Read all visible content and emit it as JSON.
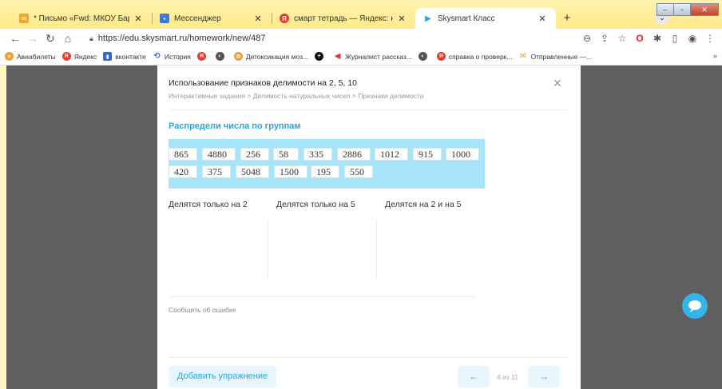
{
  "tabs": [
    {
      "title": "* Письмо «Fwd: МКОУ Барабинс",
      "favicon": "mail-icon",
      "color": "#f5a623"
    },
    {
      "title": "Мессенджер",
      "favicon": "messenger-icon",
      "color": "#3a7bd5"
    },
    {
      "title": "смарт тетрадь — Яндекс: нашёл",
      "favicon": "yandex-icon",
      "color": "#e63a2e"
    },
    {
      "title": "Skysmart Класс",
      "favicon": "skysmart-icon",
      "color": "#2aa4d9"
    }
  ],
  "address": "https://edu.skysmart.ru/homework/new/487",
  "bookmarks": [
    {
      "label": "Авиабилеты",
      "color": "#f0a030"
    },
    {
      "label": "Яндекс",
      "color": "#e63a2e"
    },
    {
      "label": "вконтакте",
      "color": "#2b6cd3"
    },
    {
      "label": "История",
      "color": "#2b6cd3"
    },
    {
      "label": "",
      "color": "#e63a2e"
    },
    {
      "label": "",
      "color": "#333333"
    },
    {
      "label": "Детоксикация моз...",
      "color": "#e8a23a"
    },
    {
      "label": "",
      "color": "#111111"
    },
    {
      "label": "Журналист рассказ...",
      "color": "#d33"
    },
    {
      "label": "",
      "color": "#333333"
    },
    {
      "label": "справка о проверк...",
      "color": "#e63a2e"
    },
    {
      "label": "Отправленные —...",
      "color": "#e9a22a"
    }
  ],
  "modal": {
    "title": "Использование признаков делимости на 2, 5, 10",
    "breadcrumbs": "Интерактивные задания > Делимость натуральных чисел > Признаки делимости",
    "task": "Распредели числа по группам",
    "numbers_row1": [
      "865",
      "4880",
      "256",
      "58",
      "335",
      "2886",
      "1012",
      "915",
      "1000"
    ],
    "numbers_row2": [
      "420",
      "375",
      "5048",
      "1500",
      "195",
      "550"
    ],
    "groups": [
      "Делятся только на 2",
      "Делятся только на 5",
      "Делятся на 2 и на 5"
    ],
    "report": "Сообщить об ошибке",
    "add_button": "Добавить упражнение",
    "pager": "4 из 11"
  },
  "colors": {
    "accent": "#2aa4d9",
    "numbers_bg": "#a7e4fa",
    "overlay": "#5f5f5f"
  }
}
